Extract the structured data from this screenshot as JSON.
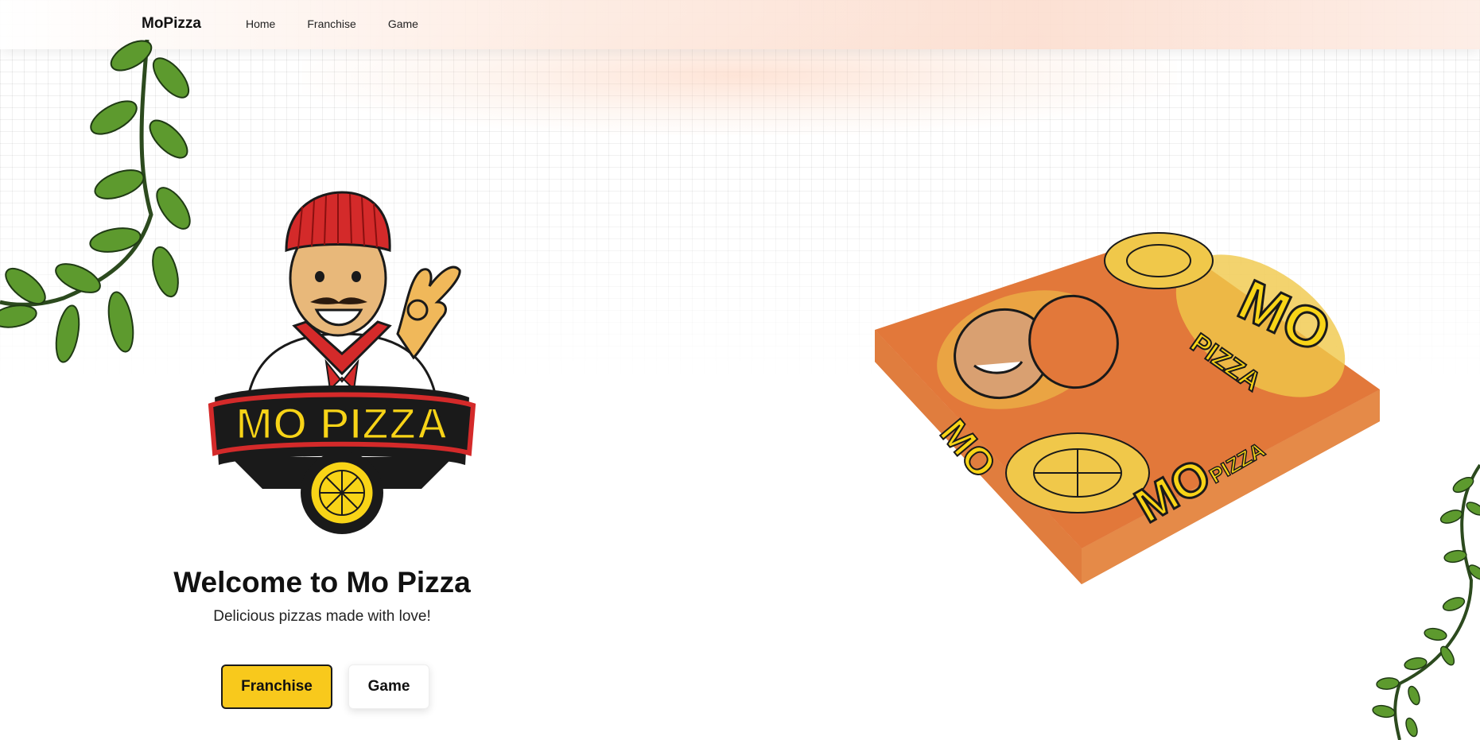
{
  "navbar": {
    "brand": "MoPizza",
    "links": [
      "Home",
      "Franchise",
      "Game"
    ]
  },
  "hero": {
    "title": "Welcome to Mo Pizza",
    "subtitle": "Delicious pizzas made with love!",
    "buttons": {
      "franchise": "Franchise",
      "game": "Game"
    }
  },
  "logo": {
    "text": "MO PIZZA"
  },
  "pizza_box": {
    "mo": "MO",
    "pizza": "PIZZA"
  },
  "colors": {
    "accent_yellow": "#f8c91c",
    "box_orange": "#e2783a",
    "chef_red": "#d42a2a",
    "leaf_green": "#5d9a2e"
  },
  "icons": [
    "vine-leaves",
    "chef-logo",
    "pizza-icon",
    "pizza-box"
  ]
}
